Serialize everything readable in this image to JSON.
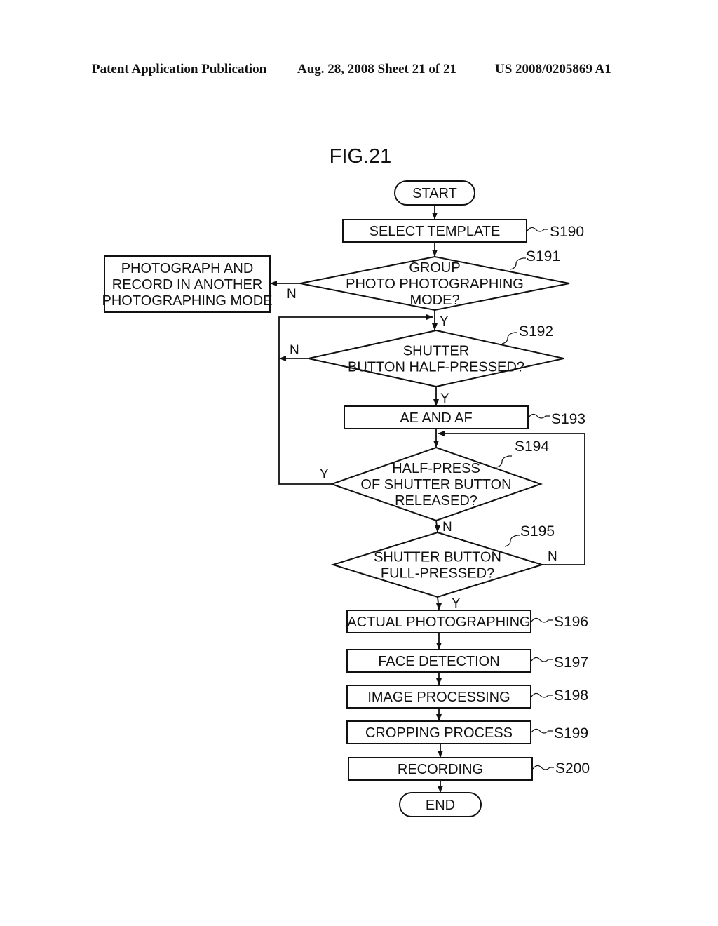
{
  "header": {
    "left": "Patent Application Publication",
    "middle": "Aug. 28, 2008  Sheet 21 of 21",
    "right": "US 2008/0205869 A1"
  },
  "figure": {
    "title": "FIG.21",
    "nodes": {
      "start": {
        "type": "terminal",
        "lines": [
          "START"
        ]
      },
      "s190": {
        "type": "process",
        "lines": [
          "SELECT TEMPLATE"
        ],
        "step": "S190"
      },
      "s191": {
        "type": "decision",
        "lines": [
          "GROUP",
          "PHOTO PHOTOGRAPHING",
          "MODE?"
        ],
        "step": "S191"
      },
      "other": {
        "type": "process",
        "lines": [
          "PHOTOGRAPH AND",
          "RECORD IN ANOTHER",
          "PHOTOGRAPHING MODE"
        ]
      },
      "s192": {
        "type": "decision",
        "lines": [
          "SHUTTER",
          "BUTTON HALF-PRESSED?"
        ],
        "step": "S192"
      },
      "s193": {
        "type": "process",
        "lines": [
          "AE AND AF"
        ],
        "step": "S193"
      },
      "s194": {
        "type": "decision",
        "lines": [
          "HALF-PRESS",
          "OF SHUTTER BUTTON",
          "RELEASED?"
        ],
        "step": "S194"
      },
      "s195": {
        "type": "decision",
        "lines": [
          "SHUTTER BUTTON",
          "FULL-PRESSED?"
        ],
        "step": "S195"
      },
      "s196": {
        "type": "process",
        "lines": [
          "ACTUAL PHOTOGRAPHING"
        ],
        "step": "S196"
      },
      "s197": {
        "type": "process",
        "lines": [
          "FACE DETECTION"
        ],
        "step": "S197"
      },
      "s198": {
        "type": "process",
        "lines": [
          "IMAGE PROCESSING"
        ],
        "step": "S198"
      },
      "s199": {
        "type": "process",
        "lines": [
          "CROPPING PROCESS"
        ],
        "step": "S199"
      },
      "s200": {
        "type": "process",
        "lines": [
          "RECORDING"
        ],
        "step": "S200"
      },
      "end": {
        "type": "terminal",
        "lines": [
          "END"
        ]
      }
    },
    "edges": [
      {
        "from": "start",
        "to": "s190",
        "label": ""
      },
      {
        "from": "s190",
        "to": "s191",
        "label": ""
      },
      {
        "from": "s191",
        "to": "other",
        "label": "N"
      },
      {
        "from": "s191",
        "to": "s192",
        "label": "Y"
      },
      {
        "from": "s192",
        "to": "s192",
        "label": "N"
      },
      {
        "from": "s192",
        "to": "s193",
        "label": "Y"
      },
      {
        "from": "s193",
        "to": "s194",
        "label": ""
      },
      {
        "from": "s194",
        "to": "s192",
        "label": "Y"
      },
      {
        "from": "s194",
        "to": "s195",
        "label": "N"
      },
      {
        "from": "s195",
        "to": "s194",
        "label": "N"
      },
      {
        "from": "s195",
        "to": "s196",
        "label": "Y"
      },
      {
        "from": "s196",
        "to": "s197",
        "label": ""
      },
      {
        "from": "s197",
        "to": "s198",
        "label": ""
      },
      {
        "from": "s198",
        "to": "s199",
        "label": ""
      },
      {
        "from": "s199",
        "to": "s200",
        "label": ""
      },
      {
        "from": "s200",
        "to": "end",
        "label": ""
      }
    ]
  }
}
